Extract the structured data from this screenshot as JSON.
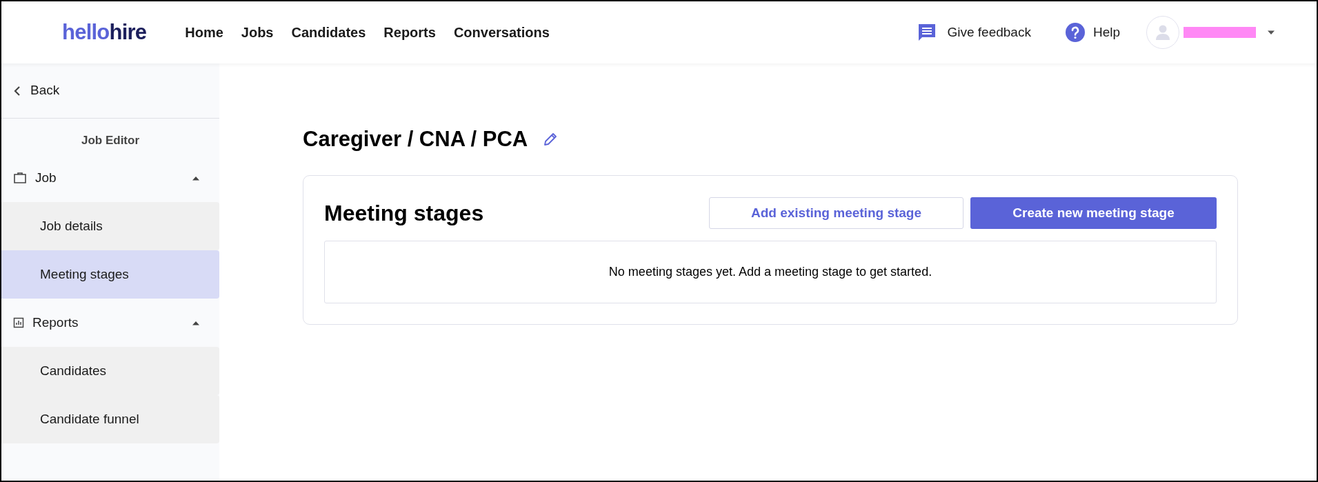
{
  "header": {
    "logo": {
      "part_1": "hello",
      "part_2": "hire"
    },
    "nav": [
      {
        "label": "Home"
      },
      {
        "label": "Jobs"
      },
      {
        "label": "Candidates"
      },
      {
        "label": "Reports"
      },
      {
        "label": "Conversations"
      }
    ],
    "feedback": "Give feedback",
    "help": "Help",
    "user": {
      "name_redacted": true
    }
  },
  "sidebar": {
    "back": "Back",
    "title": "Job Editor",
    "sections": [
      {
        "label": "Job",
        "kind": "job",
        "expanded": true,
        "children": [
          {
            "label": "Job details",
            "selected": false
          },
          {
            "label": "Meeting stages",
            "selected": true
          }
        ]
      },
      {
        "label": "Reports",
        "kind": "reports",
        "expanded": true,
        "children": [
          {
            "label": "Candidates",
            "selected": false
          },
          {
            "label": "Candidate funnel",
            "selected": false
          }
        ]
      }
    ]
  },
  "main": {
    "title": "Caregiver / CNA / PCA",
    "card": {
      "title": "Meeting stages",
      "buttons": [
        {
          "label": "Add existing meeting stage",
          "kind": "secondary"
        },
        {
          "label": "Create new meeting stage",
          "kind": "primary"
        }
      ],
      "empty_message": "No meeting stages yet. Add a meeting stage to get started."
    }
  }
}
